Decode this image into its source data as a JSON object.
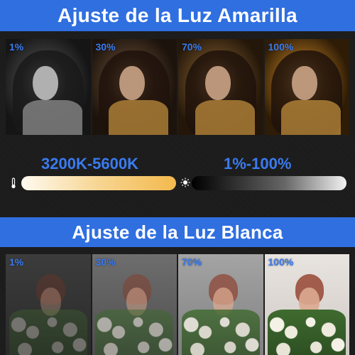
{
  "warm": {
    "title": "Ajuste de la Luz Amarilla",
    "photos": [
      {
        "label": "1%"
      },
      {
        "label": "30%"
      },
      {
        "label": "70%"
      },
      {
        "label": "100%"
      }
    ]
  },
  "sliders": {
    "temperature": {
      "label": "3200K-5600K",
      "icon": "thermometer-icon"
    },
    "brightness": {
      "label": "1%-100%",
      "icon": "sun-icon"
    }
  },
  "white": {
    "title": "Ajuste de la Luz Blanca",
    "photos": [
      {
        "label": "1%"
      },
      {
        "label": "30%"
      },
      {
        "label": "70%"
      },
      {
        "label": "100%"
      }
    ]
  },
  "colors": {
    "accent": "#2f6fe0",
    "label_blue": "#3a7bf0",
    "warm_end": "#f3b94c"
  }
}
